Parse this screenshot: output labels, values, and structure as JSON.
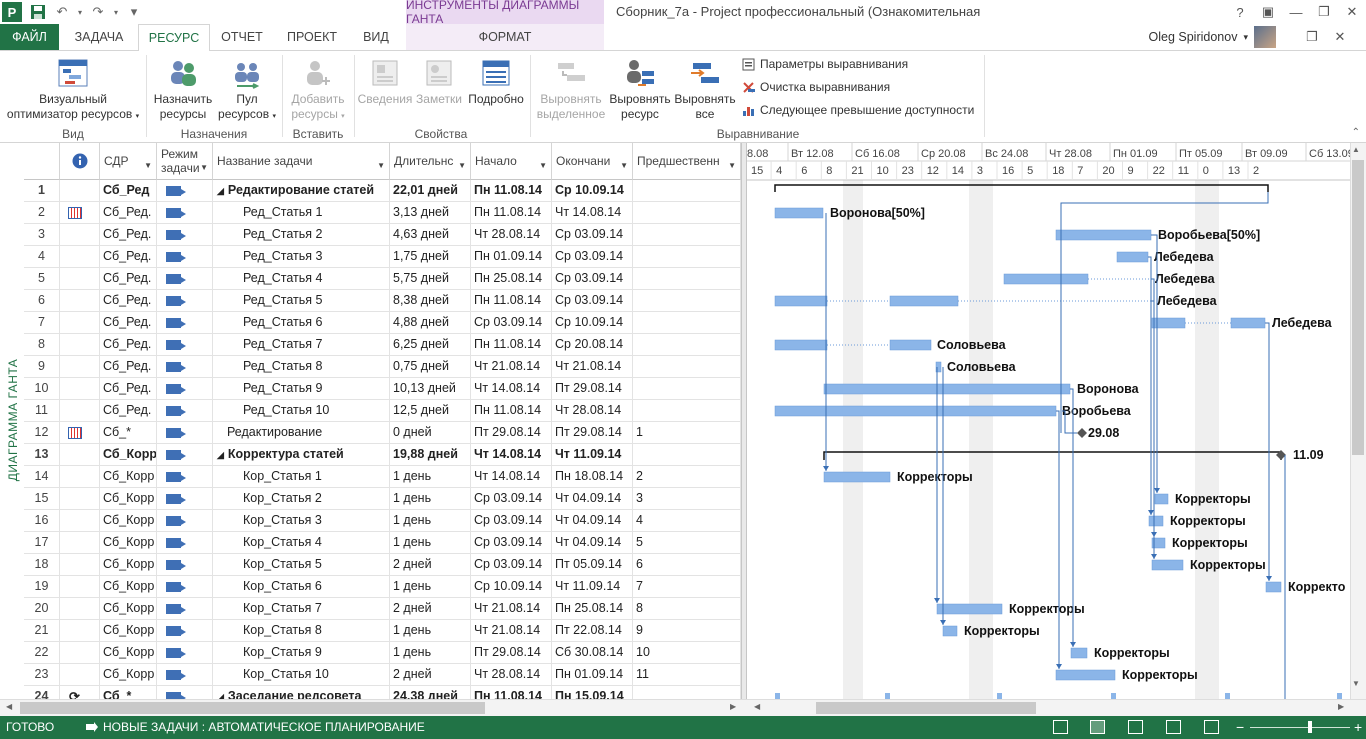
{
  "titlebar": {
    "context_tools": "ИНСТРУМЕНТЫ ДИАГРАММЫ ГАНТА",
    "window_title": "Сборник_7a - Project профессиональный (Ознакомительная версия)",
    "help": "?",
    "qat_customize": "▾"
  },
  "tabs": {
    "file": "ФАЙЛ",
    "task": "ЗАДАЧА",
    "resource": "РЕСУРС",
    "report": "ОТЧЕТ",
    "project": "ПРОЕКТ",
    "view": "ВИД",
    "format": "ФОРМАТ"
  },
  "user": {
    "name": "Oleg Spiridonov",
    "dropdown": "▾"
  },
  "ribbon": {
    "groups": {
      "view": "Вид",
      "assignments": "Назначения",
      "insert": "Вставить",
      "properties": "Свойства",
      "leveling": "Выравнивание"
    },
    "buttons": {
      "visual_optimizer_1": "Визуальный",
      "visual_optimizer_2": "оптимизатор ресурсов",
      "assign_1": "Назначить",
      "assign_2": "ресурсы",
      "pool_1": "Пул",
      "pool_2": "ресурсов",
      "add_1": "Добавить",
      "add_2": "ресурсы",
      "info": "Сведения",
      "notes": "Заметки",
      "details": "Подробно",
      "level_sel_1": "Выровнять",
      "level_sel_2": "выделенное",
      "level_res_1": "Выровнять",
      "level_res_2": "ресурс",
      "level_all_1": "Выровнять",
      "level_all_2": "все",
      "leveling_options": "Параметры выравнивания",
      "clear_leveling": "Очистка выравнивания",
      "next_overallocation": "Следующее превышение доступности"
    }
  },
  "side_label": "ДИАГРАММА ГАНТА",
  "columns": {
    "wbs": "СДР",
    "mode": "Режим задачи",
    "name": "Название задачи",
    "duration": "Длительнс",
    "start": "Начало",
    "finish": "Окончани",
    "predecessors": "Предшественн"
  },
  "rows": [
    {
      "id": "1",
      "ind": "",
      "wbs": "Сб_Ред",
      "name": "Редактирование статей",
      "dur": "22,01 дней",
      "start": "Пн 11.08.14",
      "fin": "Ср 10.09.14",
      "pred": "",
      "bold": true,
      "indent": 0,
      "summary": true
    },
    {
      "id": "2",
      "ind": "cal",
      "wbs": "Сб_Ред.",
      "name": "Ред_Статья 1",
      "dur": "3,13 дней",
      "start": "Пн 11.08.14",
      "fin": "Чт 14.08.14",
      "pred": "",
      "bold": false,
      "indent": 2
    },
    {
      "id": "3",
      "ind": "",
      "wbs": "Сб_Ред.",
      "name": "Ред_Статья 2",
      "dur": "4,63 дней",
      "start": "Чт 28.08.14",
      "fin": "Ср 03.09.14",
      "pred": "",
      "bold": false,
      "indent": 2
    },
    {
      "id": "4",
      "ind": "",
      "wbs": "Сб_Ред.",
      "name": "Ред_Статья 3",
      "dur": "1,75 дней",
      "start": "Пн 01.09.14",
      "fin": "Ср 03.09.14",
      "pred": "",
      "bold": false,
      "indent": 2
    },
    {
      "id": "5",
      "ind": "",
      "wbs": "Сб_Ред.",
      "name": "Ред_Статья 4",
      "dur": "5,75 дней",
      "start": "Пн 25.08.14",
      "fin": "Ср 03.09.14",
      "pred": "",
      "bold": false,
      "indent": 2
    },
    {
      "id": "6",
      "ind": "",
      "wbs": "Сб_Ред.",
      "name": "Ред_Статья 5",
      "dur": "8,38 дней",
      "start": "Пн 11.08.14",
      "fin": "Ср 03.09.14",
      "pred": "",
      "bold": false,
      "indent": 2
    },
    {
      "id": "7",
      "ind": "",
      "wbs": "Сб_Ред.",
      "name": "Ред_Статья 6",
      "dur": "4,88 дней",
      "start": "Ср 03.09.14",
      "fin": "Ср 10.09.14",
      "pred": "",
      "bold": false,
      "indent": 2
    },
    {
      "id": "8",
      "ind": "",
      "wbs": "Сб_Ред.",
      "name": "Ред_Статья 7",
      "dur": "6,25 дней",
      "start": "Пн 11.08.14",
      "fin": "Ср 20.08.14",
      "pred": "",
      "bold": false,
      "indent": 2
    },
    {
      "id": "9",
      "ind": "",
      "wbs": "Сб_Ред.",
      "name": "Ред_Статья 8",
      "dur": "0,75 дней",
      "start": "Чт 21.08.14",
      "fin": "Чт 21.08.14",
      "pred": "",
      "bold": false,
      "indent": 2
    },
    {
      "id": "10",
      "ind": "",
      "wbs": "Сб_Ред.",
      "name": "Ред_Статья 9",
      "dur": "10,13 дней",
      "start": "Чт 14.08.14",
      "fin": "Пт 29.08.14",
      "pred": "",
      "bold": false,
      "indent": 2
    },
    {
      "id": "11",
      "ind": "",
      "wbs": "Сб_Ред.",
      "name": "Ред_Статья 10",
      "dur": "12,5 дней",
      "start": "Пн 11.08.14",
      "fin": "Чт 28.08.14",
      "pred": "",
      "bold": false,
      "indent": 2
    },
    {
      "id": "12",
      "ind": "cal",
      "wbs": "Сб_*",
      "name": "Редактирование",
      "dur": "0 дней",
      "start": "Пт 29.08.14",
      "fin": "Пт 29.08.14",
      "pred": "1",
      "bold": false,
      "indent": 1
    },
    {
      "id": "13",
      "ind": "",
      "wbs": "Сб_Корр",
      "name": "Корректура статей",
      "dur": "19,88 дней",
      "start": "Чт 14.08.14",
      "fin": "Чт 11.09.14",
      "pred": "",
      "bold": true,
      "indent": 0,
      "summary": true
    },
    {
      "id": "14",
      "ind": "",
      "wbs": "Сб_Корр",
      "name": "Кор_Статья 1",
      "dur": "1 день",
      "start": "Чт 14.08.14",
      "fin": "Пн 18.08.14",
      "pred": "2",
      "bold": false,
      "indent": 2
    },
    {
      "id": "15",
      "ind": "",
      "wbs": "Сб_Корр",
      "name": "Кор_Статья 2",
      "dur": "1 день",
      "start": "Ср 03.09.14",
      "fin": "Чт 04.09.14",
      "pred": "3",
      "bold": false,
      "indent": 2
    },
    {
      "id": "16",
      "ind": "",
      "wbs": "Сб_Корр",
      "name": "Кор_Статья 3",
      "dur": "1 день",
      "start": "Ср 03.09.14",
      "fin": "Чт 04.09.14",
      "pred": "4",
      "bold": false,
      "indent": 2
    },
    {
      "id": "17",
      "ind": "",
      "wbs": "Сб_Корр",
      "name": "Кор_Статья 4",
      "dur": "1 день",
      "start": "Ср 03.09.14",
      "fin": "Чт 04.09.14",
      "pred": "5",
      "bold": false,
      "indent": 2
    },
    {
      "id": "18",
      "ind": "",
      "wbs": "Сб_Корр",
      "name": "Кор_Статья 5",
      "dur": "2 дней",
      "start": "Ср 03.09.14",
      "fin": "Пт 05.09.14",
      "pred": "6",
      "bold": false,
      "indent": 2
    },
    {
      "id": "19",
      "ind": "",
      "wbs": "Сб_Корр",
      "name": "Кор_Статья 6",
      "dur": "1 день",
      "start": "Ср 10.09.14",
      "fin": "Чт 11.09.14",
      "pred": "7",
      "bold": false,
      "indent": 2
    },
    {
      "id": "20",
      "ind": "",
      "wbs": "Сб_Корр",
      "name": "Кор_Статья 7",
      "dur": "2 дней",
      "start": "Чт 21.08.14",
      "fin": "Пн 25.08.14",
      "pred": "8",
      "bold": false,
      "indent": 2
    },
    {
      "id": "21",
      "ind": "",
      "wbs": "Сб_Корр",
      "name": "Кор_Статья 8",
      "dur": "1 день",
      "start": "Чт 21.08.14",
      "fin": "Пт 22.08.14",
      "pred": "9",
      "bold": false,
      "indent": 2
    },
    {
      "id": "22",
      "ind": "",
      "wbs": "Сб_Корр",
      "name": "Кор_Статья 9",
      "dur": "1 день",
      "start": "Пт 29.08.14",
      "fin": "Сб 30.08.14",
      "pred": "10",
      "bold": false,
      "indent": 2
    },
    {
      "id": "23",
      "ind": "",
      "wbs": "Сб_Корр",
      "name": "Кор_Статья 10",
      "dur": "2 дней",
      "start": "Чт 28.08.14",
      "fin": "Пн 01.09.14",
      "pred": "11",
      "bold": false,
      "indent": 2
    },
    {
      "id": "24",
      "ind": "rec",
      "wbs": "Сб_*",
      "name": "Заседание редсовета",
      "dur": "24,38 дней",
      "start": "Пн 11.08.14",
      "fin": "Пн 15.09.14",
      "pred": "",
      "bold": true,
      "indent": 0,
      "summary": true
    }
  ],
  "timescale": {
    "major": [
      "8.08",
      "Вт 12.08",
      "Сб 16.08",
      "Ср 20.08",
      "Вс 24.08",
      "Чт 28.08",
      "Пн 01.09",
      "Пт 05.09",
      "Вт 09.09",
      "Сб 13.09"
    ],
    "minor": [
      "15",
      "4",
      "6",
      "8",
      "21",
      "10",
      "23",
      "12",
      "14",
      "3",
      "16",
      "5",
      "18",
      "7",
      "20",
      "9",
      "22",
      "11",
      "0",
      "13",
      "2"
    ]
  },
  "gantt_labels": {
    "r2": "Воронова[50%]",
    "r3": "Воробьева[50%]",
    "r4": "Лебедева",
    "r5": "Лебедева",
    "r6": "Лебедева",
    "r7": "Лебедева",
    "r8": "Соловьева",
    "r9": "Соловьева",
    "r10": "Воронова",
    "r11": "Воробьева",
    "r12": "29.08",
    "r13": "11.09",
    "r14": "Корректоры",
    "r15": "Корректоры",
    "r16": "Корректоры",
    "r17": "Корректоры",
    "r18": "Корректоры",
    "r19": "Корректо",
    "r20": "Корректоры",
    "r21": "Корректоры",
    "r22": "Корректоры",
    "r23": "Корректоры"
  },
  "status": {
    "ready": "ГОТОВО",
    "new_tasks": "НОВЫЕ ЗАДАЧИ : АВТОМАТИЧЕСКОЕ ПЛАНИРОВАНИЕ",
    "zoom_minus": "−",
    "zoom_plus": "+"
  },
  "colors": {
    "accent": "#217346",
    "bar": "#8bb5e8",
    "bar_edge": "#6a9ad8",
    "link": "#3a6fb5",
    "context": "#ead9f1"
  }
}
